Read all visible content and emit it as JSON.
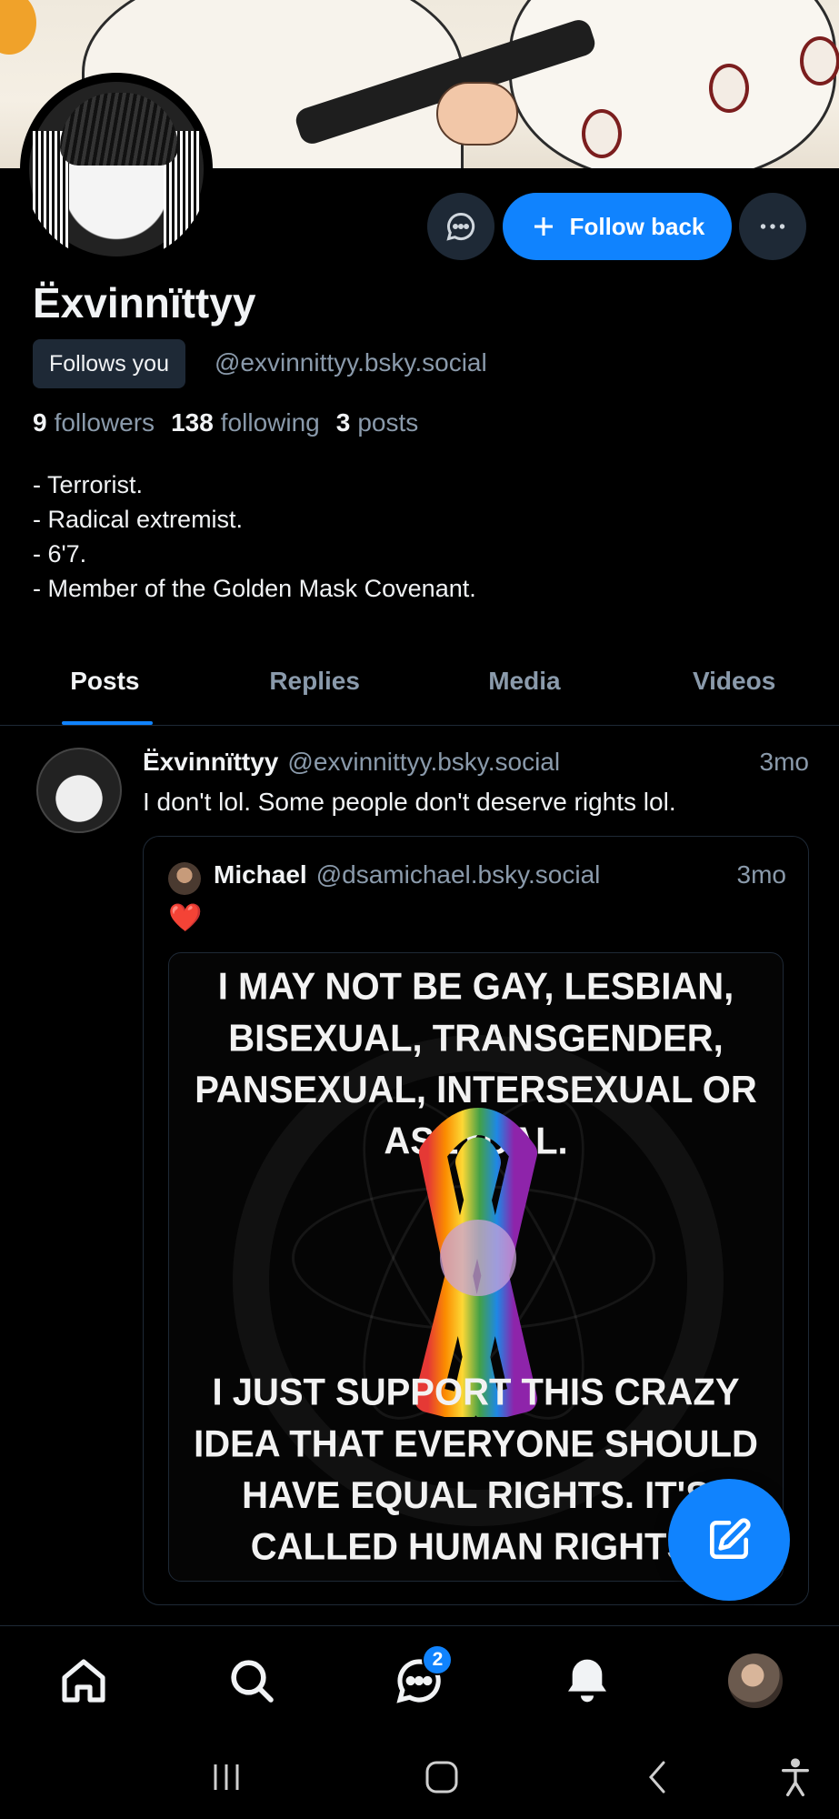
{
  "profile": {
    "display_name": "Ëxvinnïttyy",
    "handle": "@exvinnittyy.bsky.social",
    "follows_you_label": "Follows you",
    "follow_back_label": "Follow back",
    "stats": {
      "followers_count": "9",
      "followers_label": "followers",
      "following_count": "138",
      "following_label": "following",
      "posts_count": "3",
      "posts_label": "posts"
    },
    "bio": [
      "- Terrorist.",
      "- Radical extremist.",
      "- 6'7.",
      "- Member of the Golden Mask Covenant."
    ]
  },
  "tabs": [
    {
      "label": "Posts",
      "active": true
    },
    {
      "label": "Replies",
      "active": false
    },
    {
      "label": "Media",
      "active": false
    },
    {
      "label": "Videos",
      "active": false
    }
  ],
  "post": {
    "author_name": "Ëxvinnïttyy",
    "author_handle": "@exvinnittyy.bsky.social",
    "time": "3mo",
    "text": "I don't lol. Some people don't deserve rights lol.",
    "quote": {
      "author_name": "Michael",
      "author_handle": "@dsamichael.bsky.social",
      "time": "3mo",
      "text": "❤️",
      "image_text_top": "I MAY NOT BE GAY, LESBIAN, BISEXUAL, TRANSGENDER, PANSEXUAL, INTERSEXUAL OR ASEXUAL.",
      "image_text_bottom": "I JUST SUPPORT THIS CRAZY IDEA THAT EVERYONE SHOULD HAVE EQUAL RIGHTS. IT'S CALLED HUMAN RIGHTS."
    }
  },
  "nav": {
    "chat_badge": "2",
    "items": [
      "home-icon",
      "search-icon",
      "chat-icon",
      "bell-icon",
      "profile-avatar"
    ]
  },
  "colors": {
    "accent": "#1083fe",
    "background": "#000000",
    "muted": "#8a9aab",
    "surface": "#1e2936"
  }
}
